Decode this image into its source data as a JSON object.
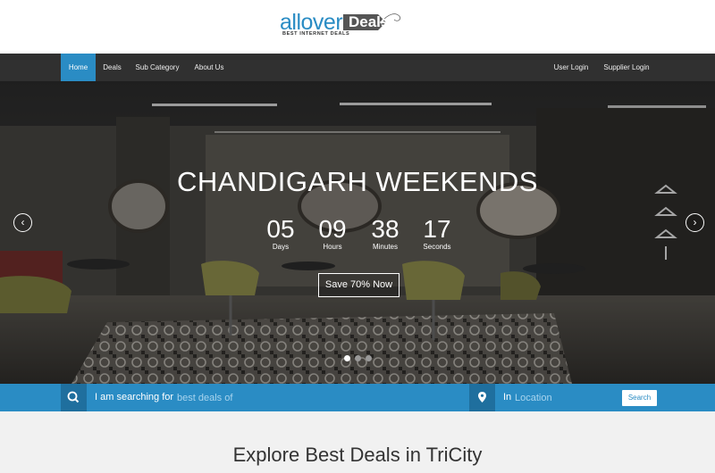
{
  "brand": {
    "logo_word": "allover",
    "logo_tag": "Deals",
    "logo_tagline": "BEST INTERNET DEALS"
  },
  "nav": {
    "left_items": [
      {
        "label": "Home",
        "active": true
      },
      {
        "label": "Deals"
      },
      {
        "label": "Sub Category"
      },
      {
        "label": "About Us"
      }
    ],
    "right_items": [
      {
        "label": "User Login"
      },
      {
        "label": "Supplier Login"
      }
    ]
  },
  "hero": {
    "title": "CHANDIGARH WEEKENDS",
    "countdown": {
      "days": {
        "value": "05",
        "label": "Days"
      },
      "hours": {
        "value": "09",
        "label": "Hours"
      },
      "minutes": {
        "value": "38",
        "label": "Minutes"
      },
      "seconds": {
        "value": "17",
        "label": "Seconds"
      }
    },
    "cta_label": "Save 70% Now",
    "prev_icon": "chevron-left-icon",
    "next_icon": "chevron-right-icon",
    "slides": 3,
    "active_slide": 1
  },
  "search": {
    "label": "I am searching for",
    "placeholder": "best deals of",
    "location_label": "In",
    "location_placeholder": "Location",
    "button_label": "Search",
    "search_icon": "search-icon",
    "location_icon": "map-marker-icon"
  },
  "explore": {
    "title": "Explore Best Deals in TriCity"
  },
  "colors": {
    "accent": "#2a8cc4",
    "nav_bg": "#303030",
    "explore_bg": "#f1f1f1"
  }
}
